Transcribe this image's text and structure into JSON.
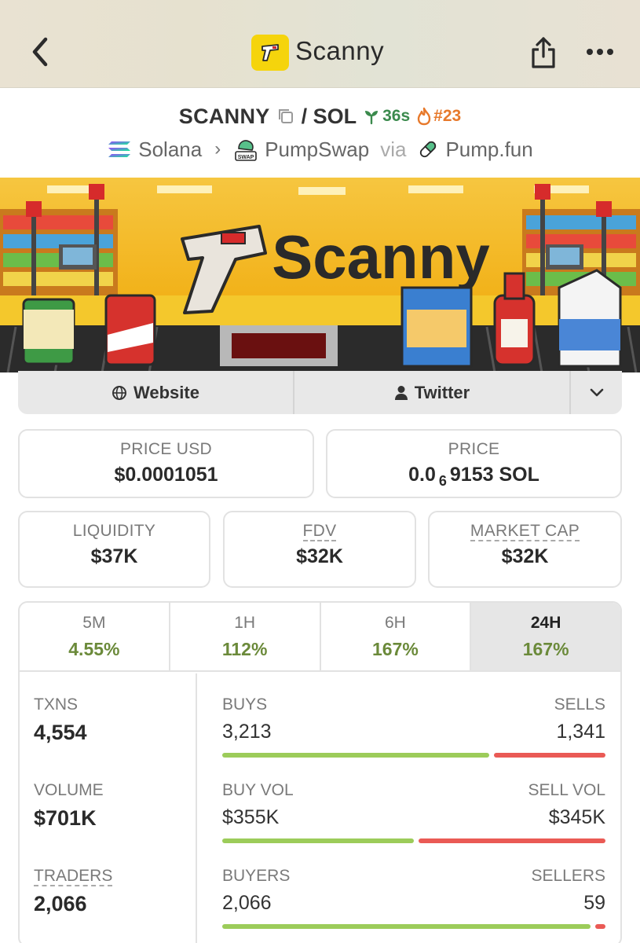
{
  "nav": {
    "title": "Scanny"
  },
  "pair": {
    "symbol": "SCANNY",
    "quote": "/ SOL",
    "age": "36s",
    "rank": "#23"
  },
  "chain": {
    "network": "Solana",
    "dex": "PumpSwap",
    "via": "via",
    "launchpad": "Pump.fun"
  },
  "banner": {
    "title": "Scanny"
  },
  "links": {
    "website": "Website",
    "twitter": "Twitter"
  },
  "price": {
    "usd_label": "PRICE USD",
    "usd_value": "$0.0001051",
    "native_label": "PRICE",
    "native_prefix": "0.0",
    "native_zeros": "6",
    "native_digits": "9153 SOL"
  },
  "metrics": [
    {
      "label": "LIQUIDITY",
      "value": "$37K"
    },
    {
      "label": "FDV",
      "value": "$32K"
    },
    {
      "label": "MARKET CAP",
      "value": "$32K"
    }
  ],
  "timeframes": [
    {
      "label": "5M",
      "change": "4.55%"
    },
    {
      "label": "1H",
      "change": "112%"
    },
    {
      "label": "6H",
      "change": "167%"
    },
    {
      "label": "24H",
      "change": "167%"
    }
  ],
  "stats": {
    "txns_label": "TXNS",
    "txns_value": "4,554",
    "volume_label": "VOLUME",
    "volume_value": "$701K",
    "traders_label": "TRADERS",
    "traders_value": "2,066"
  },
  "ratios": [
    {
      "left_label": "BUYS",
      "right_label": "SELLS",
      "left_value": "3,213",
      "right_value": "1,341",
      "left_share": 0.705
    },
    {
      "left_label": "BUY VOL",
      "right_label": "SELL VOL",
      "left_value": "$355K",
      "right_value": "$345K",
      "left_share": 0.507
    },
    {
      "left_label": "BUYERS",
      "right_label": "SELLERS",
      "left_value": "2,066",
      "right_value": "59",
      "left_share": 0.972
    }
  ],
  "colors": {
    "accent_green": "#6b8a3a",
    "bar_green": "#9ccc5a",
    "bar_red": "#ea5a55",
    "fire": "#e7792b",
    "sprout": "#3b8a4d",
    "logo_yellow": "#f5d40c"
  }
}
